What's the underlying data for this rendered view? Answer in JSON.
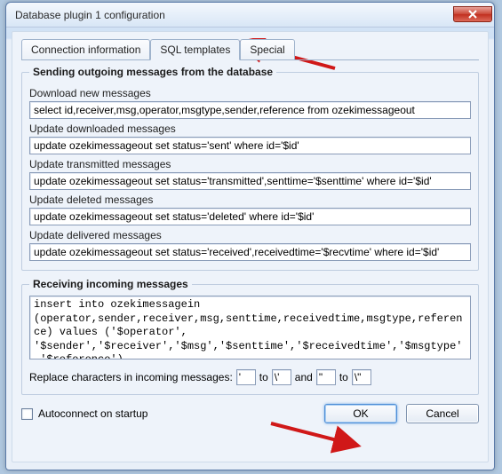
{
  "window": {
    "title": "Database plugin 1 configuration"
  },
  "tabs": {
    "connection": "Connection information",
    "sql": "SQL templates",
    "special": "Special"
  },
  "outgoing": {
    "legend": "Sending outgoing messages from the database",
    "download": {
      "label": "Download new messages",
      "value": "select id,receiver,msg,operator,msgtype,sender,reference from ozekimessageout"
    },
    "downloaded": {
      "label": "Update downloaded messages",
      "value": "update ozekimessageout set status='sent' where id='$id'"
    },
    "transmitted": {
      "label": "Update transmitted messages",
      "value": "update ozekimessageout set status='transmitted',senttime='$senttime' where id='$id'"
    },
    "deleted": {
      "label": "Update deleted messages",
      "value": "update ozekimessageout set status='deleted' where id='$id'"
    },
    "delivered": {
      "label": "Update delivered messages",
      "value": "update ozekimessageout set status='received',receivedtime='$recvtime' where id='$id'"
    }
  },
  "incoming": {
    "legend": "Receiving incoming messages",
    "sql": "insert into ozekimessagein (operator,sender,receiver,msg,senttime,receivedtime,msgtype,reference) values ('$operator', '$sender','$receiver','$msg','$senttime','$receivedtime','$msgtype','$reference')",
    "replace": {
      "label": "Replace characters in incoming messages:",
      "f1": "'",
      "t1": "\\'",
      "and": "and",
      "f2": "\"",
      "t2": "\\\"",
      "to": "to"
    }
  },
  "autoconnect": {
    "label": "Autoconnect on startup"
  },
  "buttons": {
    "ok": "OK",
    "cancel": "Cancel"
  }
}
